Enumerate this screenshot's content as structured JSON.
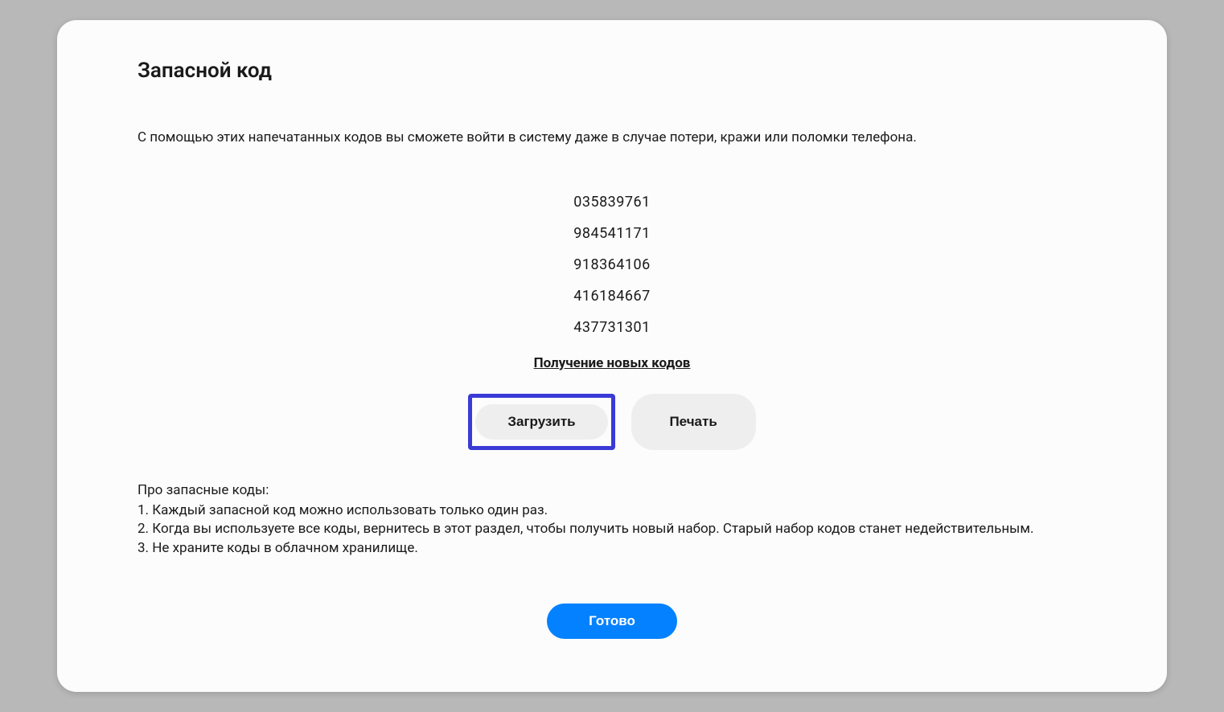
{
  "header": {
    "title": "Запасной код"
  },
  "description": "С помощью этих напечатанных кодов вы сможете войти в систему даже в случае потери, кражи или поломки телефона.",
  "codes": [
    "035839761",
    "984541171",
    "918364106",
    "416184667",
    "437731301"
  ],
  "links": {
    "get_new_codes": "Получение новых кодов"
  },
  "buttons": {
    "download": "Загрузить",
    "print": "Печать",
    "done": "Готово"
  },
  "notes": {
    "title": "Про запасные коды:",
    "items": [
      "1. Каждый запасной код можно использовать только один раз.",
      "2. Когда вы используете все коды, вернитесь в этот раздел, чтобы получить новый набор. Старый набор кодов станет недействительным.",
      "3. Не храните коды в облачном хранилище."
    ]
  }
}
